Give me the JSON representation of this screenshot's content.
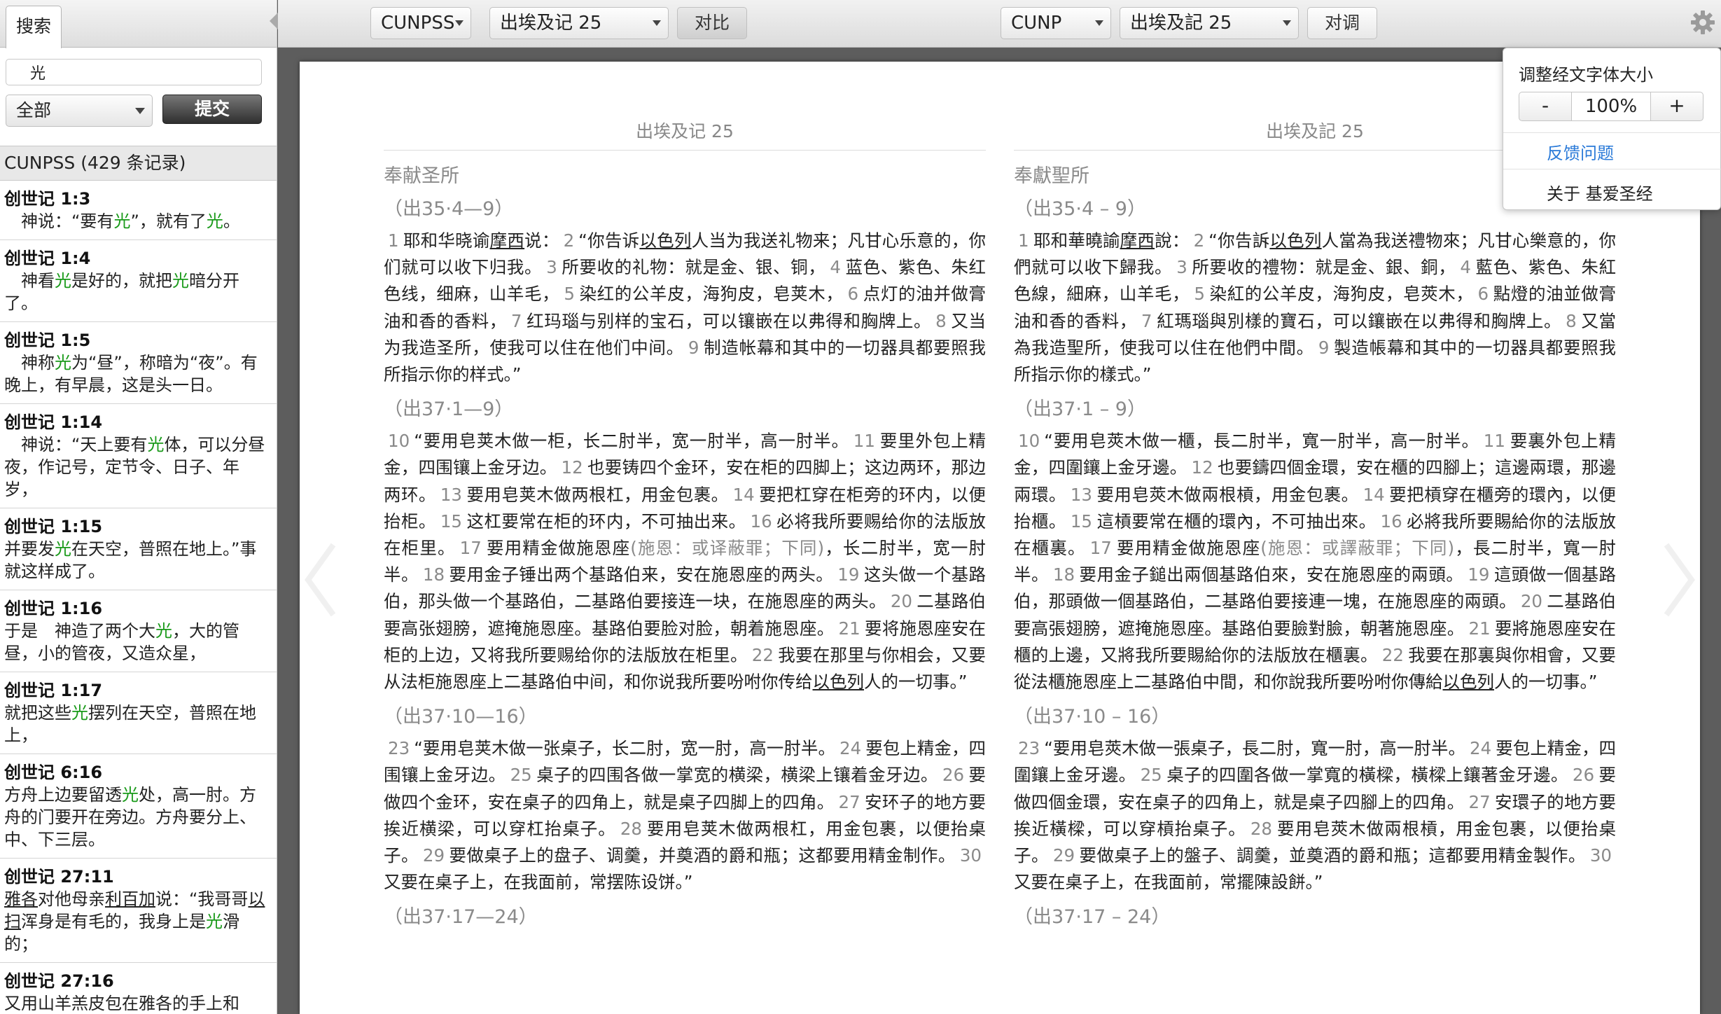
{
  "sidebar": {
    "tab_label": "搜索",
    "search_value": "光",
    "scope_value": "全部",
    "submit_label": "提交",
    "results_header": "CUNPSS (429 条记录)",
    "results": [
      {
        "ref": "创世记 1:3",
        "parts": [
          [
            "",
            "　神说：“要有"
          ],
          [
            "h",
            "光"
          ],
          [
            "",
            "”，就有了"
          ],
          [
            "h",
            "光"
          ],
          [
            "",
            "。"
          ]
        ]
      },
      {
        "ref": "创世记 1:4",
        "parts": [
          [
            "",
            "　神看"
          ],
          [
            "h",
            "光"
          ],
          [
            "",
            "是好的，就把"
          ],
          [
            "h",
            "光"
          ],
          [
            "",
            "暗分开了。"
          ]
        ]
      },
      {
        "ref": "创世记 1:5",
        "parts": [
          [
            "",
            "　神称"
          ],
          [
            "h",
            "光"
          ],
          [
            "",
            "为“昼”，称暗为“夜”。有晚上，有早晨，这是头一日。"
          ]
        ]
      },
      {
        "ref": "创世记 1:14",
        "parts": [
          [
            "",
            "　神说：“天上要有"
          ],
          [
            "h",
            "光"
          ],
          [
            "",
            "体，可以分昼夜，作记号，定节令、日子、年岁，"
          ]
        ]
      },
      {
        "ref": "创世记 1:15",
        "parts": [
          [
            "",
            "并要发"
          ],
          [
            "h",
            "光"
          ],
          [
            "",
            "在天空，普照在地上。”事就这样成了。"
          ]
        ]
      },
      {
        "ref": "创世记 1:16",
        "parts": [
          [
            "",
            "于是　神造了两个大"
          ],
          [
            "h",
            "光"
          ],
          [
            "",
            "，大的管昼，小的管夜，又造众星，"
          ]
        ]
      },
      {
        "ref": "创世记 1:17",
        "parts": [
          [
            "",
            "就把这些"
          ],
          [
            "h",
            "光"
          ],
          [
            "",
            "摆列在天空，普照在地上，"
          ]
        ]
      },
      {
        "ref": "创世记 6:16",
        "parts": [
          [
            "",
            "方舟上边要留透"
          ],
          [
            "h",
            "光"
          ],
          [
            "",
            "处，高一肘。方舟的门要开在旁边。方舟要分上、中、下三层。"
          ]
        ]
      },
      {
        "ref": "创世记 27:11",
        "parts": [
          [
            "u",
            "雅各"
          ],
          [
            "",
            "对他母亲"
          ],
          [
            "u",
            "利百加"
          ],
          [
            "",
            "说：“我哥哥"
          ],
          [
            "u",
            "以扫"
          ],
          [
            "",
            "浑身是有毛的，我身上是"
          ],
          [
            "h",
            "光"
          ],
          [
            "",
            "滑的；"
          ]
        ]
      },
      {
        "ref": "创世记 27:16",
        "parts": [
          [
            "",
            "又用山羊羔皮包在雅各的手上和"
          ]
        ]
      }
    ]
  },
  "toolbar": {
    "left_version": "CUNPSS",
    "left_book": "出埃及记 25",
    "compare_label": "对比",
    "right_version": "CUNP",
    "right_book": "出埃及記 25",
    "swap_label": "对调"
  },
  "settings_popup": {
    "title": "调整经文字体大小",
    "minus": "-",
    "font_size": "100%",
    "plus": "+",
    "feedback": "反馈问题",
    "about": "关于 基爱圣经"
  },
  "left_column": {
    "chapter_title": "出埃及记 25",
    "section_title": "奉献圣所",
    "blocks": [
      {
        "ref": "（出35·4—9）",
        "parts": [
          [
            "v",
            "1"
          ],
          [
            "",
            "耶和华晓谕"
          ],
          [
            "u",
            "摩西"
          ],
          [
            "",
            "说："
          ],
          [
            "v",
            "2"
          ],
          [
            "",
            "“你告诉"
          ],
          [
            "u",
            "以色列"
          ],
          [
            "",
            "人当为我送礼物来；凡甘心乐意的，你们就可以收下归我。"
          ],
          [
            "v",
            "3"
          ],
          [
            "",
            "所要收的礼物：就是金、银、铜，"
          ],
          [
            "v",
            "4"
          ],
          [
            "",
            "蓝色、紫色、朱红色线，细麻，山羊毛，"
          ],
          [
            "v",
            "5"
          ],
          [
            "",
            "染红的公羊皮，海狗皮，皂荚木，"
          ],
          [
            "v",
            "6"
          ],
          [
            "",
            "点灯的油并做膏油和香的香料，"
          ],
          [
            "v",
            "7"
          ],
          [
            "",
            "红玛瑙与别样的宝石，可以镶嵌在以弗得和胸牌上。"
          ],
          [
            "v",
            "8"
          ],
          [
            "",
            "又当为我造圣所，使我可以住在他们中间。"
          ],
          [
            "v",
            "9"
          ],
          [
            "",
            "制造帐幕和其中的一切器具都要照我所指示你的样式。”"
          ]
        ]
      },
      {
        "ref": "（出37·1—9）",
        "parts": [
          [
            "v",
            "10"
          ],
          [
            "",
            "“要用皂荚木做一柜，长二肘半，宽一肘半，高一肘半。"
          ],
          [
            "v",
            "11"
          ],
          [
            "",
            "要里外包上精金，四围镶上金牙边。"
          ],
          [
            "v",
            "12"
          ],
          [
            "",
            "也要铸四个金环，安在柜的四脚上；这边两环，那边两环。"
          ],
          [
            "v",
            "13"
          ],
          [
            "",
            "要用皂荚木做两根杠，用金包裹。"
          ],
          [
            "v",
            "14"
          ],
          [
            "",
            "要把杠穿在柜旁的环内，以便抬柜。"
          ],
          [
            "v",
            "15"
          ],
          [
            "",
            "这杠要常在柜的环内，不可抽出来。"
          ],
          [
            "v",
            "16"
          ],
          [
            "",
            "必将我所要赐给你的法版放在柜里。"
          ],
          [
            "v",
            "17"
          ],
          [
            "",
            "要用精金做施恩座"
          ],
          [
            "n",
            "(施恩：或译蔽罪；下同)"
          ],
          [
            "",
            "，长二肘半，宽一肘半。"
          ],
          [
            "v",
            "18"
          ],
          [
            "",
            "要用金子锤出两个基路伯来，安在施恩座的两头。"
          ],
          [
            "v",
            "19"
          ],
          [
            "",
            "这头做一个基路伯，那头做一个基路伯，二基路伯要接连一块，在施恩座的两头。"
          ],
          [
            "v",
            "20"
          ],
          [
            "",
            "二基路伯要高张翅膀，遮掩施恩座。基路伯要脸对脸，朝着施恩座。"
          ],
          [
            "v",
            "21"
          ],
          [
            "",
            "要将施恩座安在柜的上边，又将我所要赐给你的法版放在柜里。"
          ],
          [
            "v",
            "22"
          ],
          [
            "",
            "我要在那里与你相会，又要从法柜施恩座上二基路伯中间，和你说我所要吩咐你传给"
          ],
          [
            "u",
            "以色列"
          ],
          [
            "",
            "人的一切事。”"
          ]
        ]
      },
      {
        "ref": "（出37·10—16）",
        "parts": [
          [
            "v",
            "23"
          ],
          [
            "",
            "“要用皂荚木做一张桌子，长二肘，宽一肘，高一肘半。"
          ],
          [
            "v",
            "24"
          ],
          [
            "",
            "要包上精金，四围镶上金牙边。"
          ],
          [
            "v",
            "25"
          ],
          [
            "",
            "桌子的四围各做一掌宽的横梁，横梁上镶着金牙边。"
          ],
          [
            "v",
            "26"
          ],
          [
            "",
            "要做四个金环，安在桌子的四角上，就是桌子四脚上的四角。"
          ],
          [
            "v",
            "27"
          ],
          [
            "",
            "安环子的地方要挨近横梁，可以穿杠抬桌子。"
          ],
          [
            "v",
            "28"
          ],
          [
            "",
            "要用皂荚木做两根杠，用金包裹，以便抬桌子。"
          ],
          [
            "v",
            "29"
          ],
          [
            "",
            "要做桌子上的盘子、调羹，并奠酒的爵和瓶；这都要用精金制作。"
          ],
          [
            "v",
            "30"
          ],
          [
            "",
            "又要在桌子上，在我面前，常摆陈设饼。”"
          ]
        ]
      },
      {
        "ref": "（出37·17—24）",
        "parts": []
      }
    ]
  },
  "right_column": {
    "chapter_title": "出埃及記 25",
    "section_title": "奉獻聖所",
    "blocks": [
      {
        "ref": "（出35·4 – 9）",
        "parts": [
          [
            "v",
            "1"
          ],
          [
            "",
            "耶和華曉諭"
          ],
          [
            "u",
            "摩西"
          ],
          [
            "",
            "說："
          ],
          [
            "v",
            "2"
          ],
          [
            "",
            "“你告訴"
          ],
          [
            "u",
            "以色列"
          ],
          [
            "",
            "人當為我送禮物來；凡甘心樂意的，你們就可以收下歸我。"
          ],
          [
            "v",
            "3"
          ],
          [
            "",
            "所要收的禮物：就是金、銀、銅，"
          ],
          [
            "v",
            "4"
          ],
          [
            "",
            "藍色、紫色、朱紅色線，細麻，山羊毛，"
          ],
          [
            "v",
            "5"
          ],
          [
            "",
            "染紅的公羊皮，海狗皮，皂莢木，"
          ],
          [
            "v",
            "6"
          ],
          [
            "",
            "點燈的油並做膏油和香的香料，"
          ],
          [
            "v",
            "7"
          ],
          [
            "",
            "紅瑪瑙與別樣的寶石，可以鑲嵌在以弗得和胸牌上。"
          ],
          [
            "v",
            "8"
          ],
          [
            "",
            "又當為我造聖所，使我可以住在他們中間。"
          ],
          [
            "v",
            "9"
          ],
          [
            "",
            "製造帳幕和其中的一切器具都要照我所指示你的樣式。”"
          ]
        ]
      },
      {
        "ref": "（出37·1 – 9）",
        "parts": [
          [
            "v",
            "10"
          ],
          [
            "",
            "“要用皂莢木做一櫃，長二肘半，寬一肘半，高一肘半。"
          ],
          [
            "v",
            "11"
          ],
          [
            "",
            "要裏外包上精金，四圍鑲上金牙邊。"
          ],
          [
            "v",
            "12"
          ],
          [
            "",
            "也要鑄四個金環，安在櫃的四腳上；這邊兩環，那邊兩環。"
          ],
          [
            "v",
            "13"
          ],
          [
            "",
            "要用皂莢木做兩根槓，用金包裹。"
          ],
          [
            "v",
            "14"
          ],
          [
            "",
            "要把槓穿在櫃旁的環內，以便抬櫃。"
          ],
          [
            "v",
            "15"
          ],
          [
            "",
            "這槓要常在櫃的環內，不可抽出來。"
          ],
          [
            "v",
            "16"
          ],
          [
            "",
            "必將我所要賜給你的法版放在櫃裏。"
          ],
          [
            "v",
            "17"
          ],
          [
            "",
            "要用精金做施恩座"
          ],
          [
            "n",
            "(施恩：或譯蔽罪；下同)"
          ],
          [
            "",
            "，長二肘半，寬一肘半。"
          ],
          [
            "v",
            "18"
          ],
          [
            "",
            "要用金子鎚出兩個基路伯來，安在施恩座的兩頭。"
          ],
          [
            "v",
            "19"
          ],
          [
            "",
            "這頭做一個基路伯，那頭做一個基路伯，二基路伯要接連一塊，在施恩座的兩頭。"
          ],
          [
            "v",
            "20"
          ],
          [
            "",
            "二基路伯要高張翅膀，遮掩施恩座。基路伯要臉對臉，朝著施恩座。"
          ],
          [
            "v",
            "21"
          ],
          [
            "",
            "要將施恩座安在櫃的上邊，又將我所要賜給你的法版放在櫃裏。"
          ],
          [
            "v",
            "22"
          ],
          [
            "",
            "我要在那裏與你相會，又要從法櫃施恩座上二基路伯中間，和你說我所要吩咐你傳給"
          ],
          [
            "u",
            "以色列"
          ],
          [
            "",
            "人的一切事。”"
          ]
        ]
      },
      {
        "ref": "（出37·10 – 16）",
        "parts": [
          [
            "v",
            "23"
          ],
          [
            "",
            "“要用皂莢木做一張桌子，長二肘，寬一肘，高一肘半。"
          ],
          [
            "v",
            "24"
          ],
          [
            "",
            "要包上精金，四圍鑲上金牙邊。"
          ],
          [
            "v",
            "25"
          ],
          [
            "",
            "桌子的四圍各做一掌寬的橫樑，橫樑上鑲著金牙邊。"
          ],
          [
            "v",
            "26"
          ],
          [
            "",
            "要做四個金環，安在桌子的四角上，就是桌子四腳上的四角。"
          ],
          [
            "v",
            "27"
          ],
          [
            "",
            "安環子的地方要挨近橫樑，可以穿槓抬桌子。"
          ],
          [
            "v",
            "28"
          ],
          [
            "",
            "要用皂莢木做兩根槓，用金包裹，以便抬桌子。"
          ],
          [
            "v",
            "29"
          ],
          [
            "",
            "要做桌子上的盤子、調羹，並奠酒的爵和瓶；這都要用精金製作。"
          ],
          [
            "v",
            "30"
          ],
          [
            "",
            "又要在桌子上，在我面前，常擺陳設餅。”"
          ]
        ]
      },
      {
        "ref": "（出37·17 – 24）",
        "parts": []
      }
    ]
  },
  "icons": {
    "search": "search-icon",
    "gear": "gear-icon",
    "collapse": "collapse-sidebar-icon",
    "prev": "prev-chapter-icon",
    "next": "next-chapter-icon"
  }
}
